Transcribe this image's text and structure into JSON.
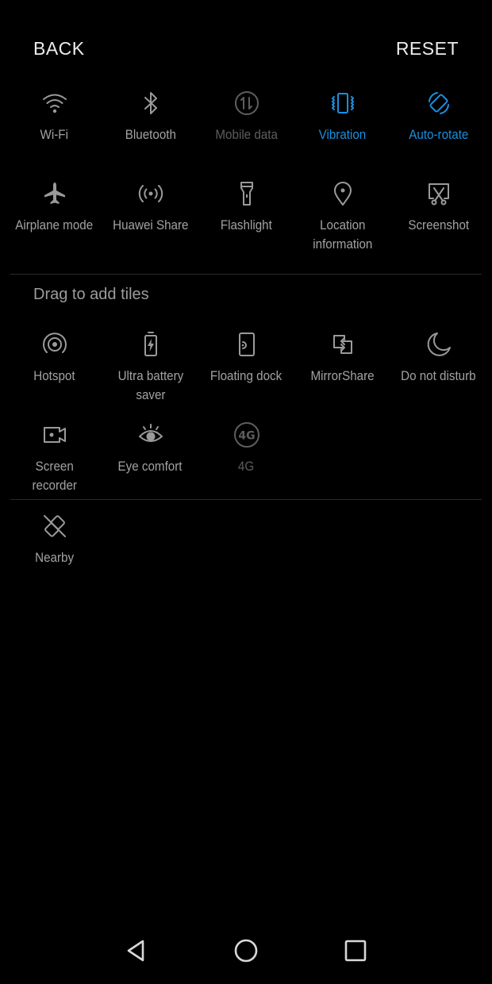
{
  "header": {
    "back_label": "BACK",
    "reset_label": "RESET"
  },
  "colors": {
    "accent": "#1a8fe0",
    "icon": "#9a9a9a",
    "dim": "#5e5e5e",
    "background": "#000000"
  },
  "active_tiles": [
    {
      "label": "Wi-Fi",
      "icon": "wifi-icon",
      "state": "normal"
    },
    {
      "label": "Bluetooth",
      "icon": "bluetooth-icon",
      "state": "normal"
    },
    {
      "label": "Mobile data",
      "icon": "mobile-data-icon",
      "state": "disabled"
    },
    {
      "label": "Vibration",
      "icon": "vibration-icon",
      "state": "active"
    },
    {
      "label": "Auto-rotate",
      "icon": "auto-rotate-icon",
      "state": "active"
    },
    {
      "label": "Airplane mode",
      "icon": "airplane-icon",
      "state": "normal"
    },
    {
      "label": "Huawei Share",
      "icon": "huawei-share-icon",
      "state": "normal"
    },
    {
      "label": "Flashlight",
      "icon": "flashlight-icon",
      "state": "normal"
    },
    {
      "label": "Location\ninformation",
      "icon": "location-icon",
      "state": "normal"
    },
    {
      "label": "Screenshot",
      "icon": "screenshot-icon",
      "state": "normal"
    }
  ],
  "drag_section": {
    "title": "Drag to add tiles",
    "tiles": [
      {
        "label": "Hotspot",
        "icon": "hotspot-icon",
        "state": "normal"
      },
      {
        "label": "Ultra battery\nsaver",
        "icon": "battery-saver-icon",
        "state": "normal"
      },
      {
        "label": "Floating dock",
        "icon": "floating-dock-icon",
        "state": "normal"
      },
      {
        "label": "MirrorShare",
        "icon": "mirrorshare-icon",
        "state": "normal"
      },
      {
        "label": "Do not disturb",
        "icon": "moon-icon",
        "state": "normal"
      },
      {
        "label": "Screen\nrecorder",
        "icon": "screen-recorder-icon",
        "state": "normal"
      },
      {
        "label": "Eye comfort",
        "icon": "eye-icon",
        "state": "normal"
      },
      {
        "label": "4G",
        "icon": "4g-icon",
        "state": "disabled"
      }
    ]
  },
  "extra_tiles": [
    {
      "label": "Nearby",
      "icon": "nearby-icon",
      "state": "normal"
    }
  ],
  "navbar": {
    "back": "nav-back-icon",
    "home": "nav-home-icon",
    "recents": "nav-recents-icon"
  }
}
